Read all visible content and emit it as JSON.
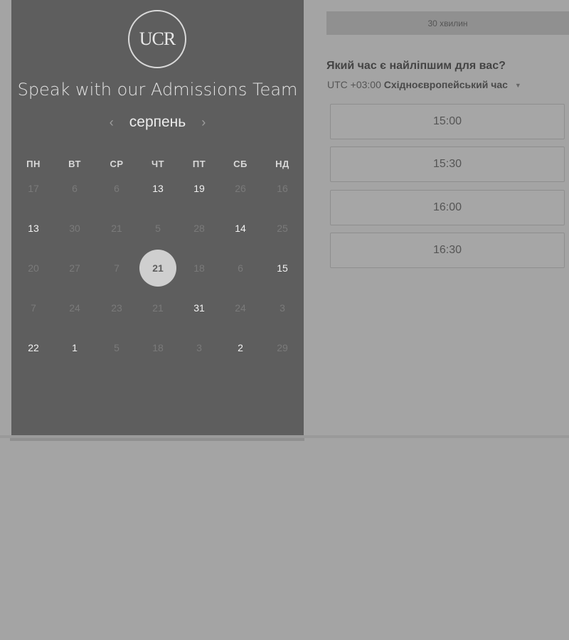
{
  "brand": {
    "logo_text": "UCR"
  },
  "left": {
    "headline": "Speak with our Admissions Team",
    "month": "серпень",
    "prev_icon": "chevron-left-icon",
    "next_icon": "chevron-right-icon",
    "weekdays": [
      "ПН",
      "ВТ",
      "СР",
      "ЧТ",
      "ПТ",
      "СБ",
      "НД"
    ],
    "weeks": [
      [
        "17",
        "6",
        "6",
        "13",
        "19",
        "26",
        "16"
      ],
      [
        "13",
        "30",
        "21",
        "5",
        "28",
        "14",
        "25"
      ],
      [
        "20",
        "27",
        "7",
        "21",
        "18",
        "6",
        "15"
      ],
      [
        "7",
        "24",
        "23",
        "21",
        "31",
        "24",
        "3"
      ],
      [
        "22",
        "1",
        "5",
        "18",
        "3",
        "2",
        "29"
      ]
    ],
    "active_days": [
      "19",
      "13",
      "14",
      "15",
      "31",
      "22",
      "1",
      "2"
    ],
    "selected_day": "21"
  },
  "right": {
    "duration": "30 хвилин",
    "heading": "Який час є найліпшим для вас?",
    "timezone_prefix": "UTC +03:00",
    "timezone_name": "Східноєвропейський час",
    "slots": [
      "15:00",
      "15:30",
      "16:00",
      "16:30"
    ]
  },
  "colors": {
    "panel": "#5e5e5e",
    "page": "#a4a4a4",
    "selected": "#cfcfcf"
  }
}
